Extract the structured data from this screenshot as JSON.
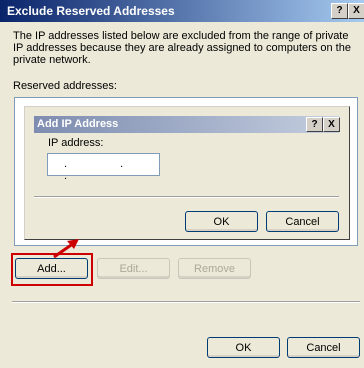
{
  "dialog": {
    "title": "Exclude Reserved Addresses",
    "help_label": "?",
    "close_label": "X",
    "description": "The IP addresses listed below are excluded from the range of private IP addresses because they are already assigned to computers on the private network.",
    "reserved_label": "Reserved addresses:",
    "buttons": {
      "add": "Add...",
      "edit": "Edit...",
      "remove": "Remove",
      "ok": "OK",
      "cancel": "Cancel"
    }
  },
  "inner_dialog": {
    "title": "Add IP Address",
    "help_label": "?",
    "close_label": "X",
    "ip_label": "IP address:",
    "ip_value": ". . .",
    "buttons": {
      "ok": "OK",
      "cancel": "Cancel"
    }
  },
  "colors": {
    "highlight": "#cc0000",
    "title_active": "#0a246a"
  }
}
